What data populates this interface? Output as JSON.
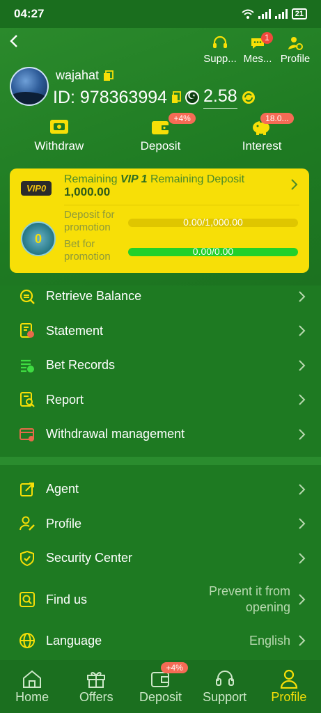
{
  "status": {
    "time": "04:27",
    "battery": "21"
  },
  "header": {
    "icons": [
      {
        "label": "Supp...",
        "icon": "headset-icon"
      },
      {
        "label": "Mes...",
        "icon": "message-icon",
        "badge": "1"
      },
      {
        "label": "Profile",
        "icon": "profile-settings-icon"
      }
    ]
  },
  "user": {
    "name": "wajahat",
    "id": "ID: 978363994",
    "balance": "2.58"
  },
  "actions": [
    {
      "label": "Withdraw",
      "icon": "withdraw-icon"
    },
    {
      "label": "Deposit",
      "icon": "deposit-wallet-icon",
      "badge": "+4%"
    },
    {
      "label": "Interest",
      "icon": "piggy-bank-icon",
      "badge": "18.0..."
    }
  ],
  "vip": {
    "tag": "VIP0",
    "title_prefix": "Remaining",
    "level": "VIP 1",
    "title_suffix": "Remaining Deposit",
    "amount": "1,000.00",
    "medal": "0",
    "deposit_label": "Deposit for promotion",
    "deposit_text": "0.00/1,000.00",
    "deposit_progress": 0,
    "bet_label": "Bet for promotion",
    "bet_text": "0.00/0.00",
    "bet_progress": 100
  },
  "menu1": [
    {
      "label": "Retrieve Balance",
      "icon": "retrieve-balance-icon"
    },
    {
      "label": "Statement",
      "icon": "statement-icon"
    },
    {
      "label": "Bet Records",
      "icon": "bet-records-icon"
    },
    {
      "label": "Report",
      "icon": "report-icon"
    },
    {
      "label": "Withdrawal management",
      "icon": "withdrawal-management-icon"
    }
  ],
  "menu2": [
    {
      "label": "Agent",
      "icon": "agent-share-icon"
    },
    {
      "label": "Profile",
      "icon": "user-edit-icon"
    },
    {
      "label": "Security Center",
      "icon": "shield-check-icon"
    },
    {
      "label": "Find us",
      "icon": "find-us-icon",
      "value_line1": "Prevent it from",
      "value_line2": "opening"
    },
    {
      "label": "Language",
      "icon": "globe-icon",
      "value": "English"
    }
  ],
  "nav": [
    {
      "label": "Home",
      "icon": "home-icon"
    },
    {
      "label": "Offers",
      "icon": "gift-icon"
    },
    {
      "label": "Deposit",
      "icon": "wallet-icon",
      "badge": "+4%"
    },
    {
      "label": "Support",
      "icon": "headset-icon"
    },
    {
      "label": "Profile",
      "icon": "person-icon",
      "active": true
    }
  ],
  "colors": {
    "bg": "#1e7a22",
    "accent": "#f7df07",
    "badge": "#f04a3c",
    "progress": "#22d12a"
  }
}
